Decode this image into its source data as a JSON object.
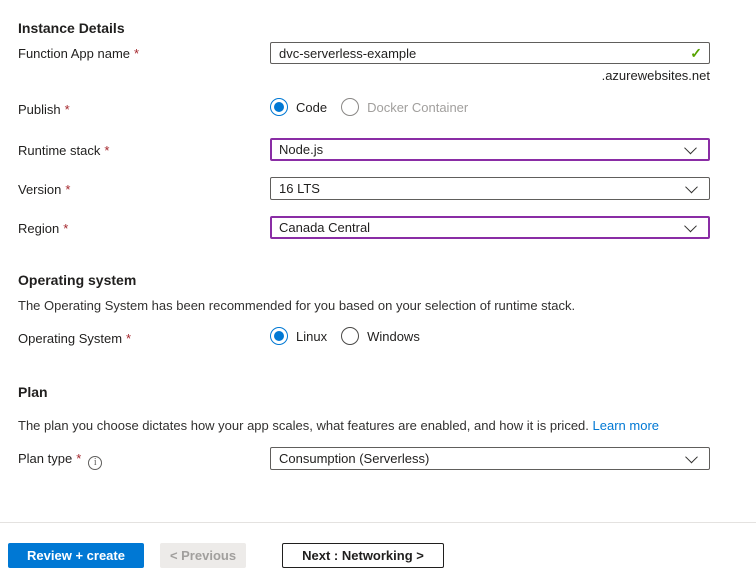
{
  "form": {
    "required_marker": "*",
    "instance_details": {
      "title": "Instance Details",
      "function_app_name": {
        "label": "Function App name",
        "value": "dvc-serverless-example",
        "domain_suffix": ".azurewebsites.net"
      },
      "publish": {
        "label": "Publish",
        "options": [
          {
            "label": "Code",
            "selected": true
          },
          {
            "label": "Docker Container",
            "selected": false
          }
        ]
      },
      "runtime_stack": {
        "label": "Runtime stack",
        "selected": "Node.js"
      },
      "version": {
        "label": "Version",
        "selected": "16 LTS"
      },
      "region": {
        "label": "Region",
        "selected": "Canada Central"
      }
    },
    "operating_system": {
      "title": "Operating system",
      "description": "The Operating System has been recommended for you based on your selection of runtime stack.",
      "field": {
        "label": "Operating System",
        "options": [
          {
            "label": "Linux",
            "selected": true
          },
          {
            "label": "Windows",
            "selected": false
          }
        ]
      }
    },
    "plan": {
      "title": "Plan",
      "description": "The plan you choose dictates how your app scales, what features are enabled, and how it is priced.",
      "learn_more": "Learn more",
      "plan_type": {
        "label": "Plan type",
        "selected": "Consumption (Serverless)"
      }
    }
  },
  "icons": {
    "valid_check": "✓",
    "info": "i"
  },
  "footer": {
    "review_create_label": "Review + create",
    "previous_label": "< Previous",
    "next_label": "Next : Networking >"
  },
  "colors": {
    "accent_blue": "#0078d4",
    "dirty_field_purple": "#8a2da5",
    "required_red": "#a4262c",
    "valid_green": "#57a300",
    "link_blue": "#0078d4"
  }
}
